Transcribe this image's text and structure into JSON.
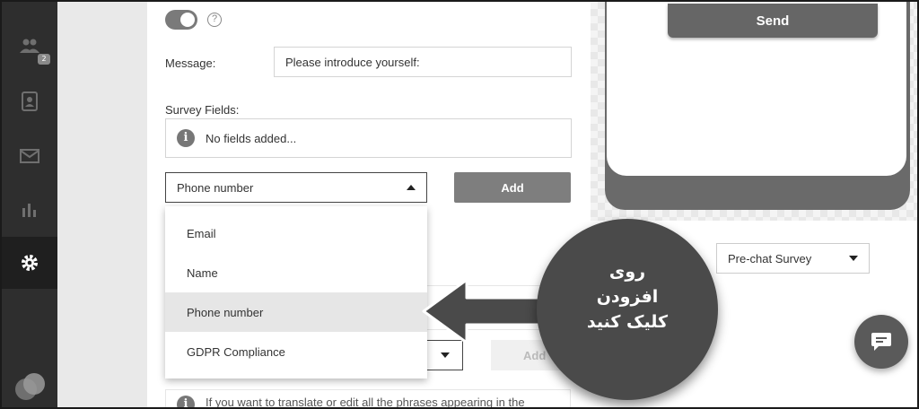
{
  "sidebar": {
    "items": [
      {
        "icon": "users-icon",
        "badge": "2"
      },
      {
        "icon": "contacts-icon"
      },
      {
        "icon": "inbox-icon"
      },
      {
        "icon": "chart-icon"
      },
      {
        "icon": "gear-icon",
        "active": true
      }
    ],
    "logo": "brand-logo"
  },
  "settings": {
    "toggle_state": "on",
    "message_label": "Message:",
    "message_value": "Please introduce yourself:",
    "survey_label": "Survey Fields:",
    "no_fields_text": "No fields added...",
    "field_select_value": "Phone number",
    "add_label": "Add",
    "add_label_faint": "Add",
    "dropdown_options": [
      "Email",
      "Name",
      "Phone number",
      "GDPR Compliance"
    ],
    "highlighted_option": "Phone number",
    "bottom_info_text": "If you want to translate or edit all the phrases appearing in the"
  },
  "preview": {
    "send_label": "Send",
    "survey_type_value": "Pre-chat Survey"
  },
  "annotation": {
    "line1": "روی",
    "line2": "افزودن",
    "line3": "کلیک کنید"
  },
  "colors": {
    "sidebar_bg": "#2e2e2e",
    "accent_gray": "#7e7e7e",
    "callout_bg": "#4a4a4a"
  }
}
